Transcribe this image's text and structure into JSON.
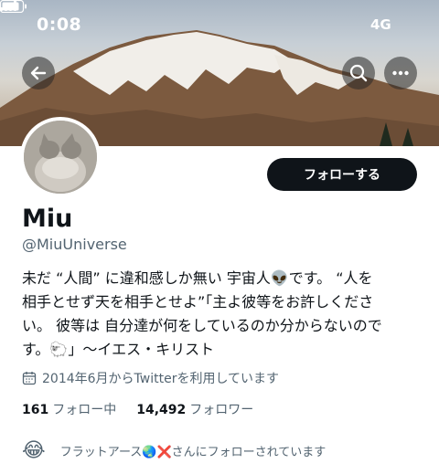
{
  "status_bar": {
    "time": "0:08",
    "network": "4G"
  },
  "header": {
    "back_icon": "arrow-left-icon",
    "search_icon": "search-icon",
    "more_icon": "more-horizontal-icon"
  },
  "profile": {
    "follow_label": "フォローする",
    "name": "Miu",
    "handle": "@MiuUniverse",
    "bio_lines": [
      "未だ “人間” に違和感しか無い 宇宙人👽です。 “人を",
      "相手とせず天を相手とせよ”「主よ彼等をお許しくださ",
      "い。 彼等は 自分達が何をしているのか分からないので",
      "す。🐑」〜イエス・キリスト"
    ],
    "joined_icon": "calendar-icon",
    "joined": "2014年6月からTwitterを利用しています",
    "following_count": "161",
    "following_label": "フォロー中",
    "followers_count": "14,492",
    "followers_label": "フォロワー",
    "followed_by_emoji": "😂",
    "followed_by": "フラットアース🌏❌さんにフォローされています"
  }
}
